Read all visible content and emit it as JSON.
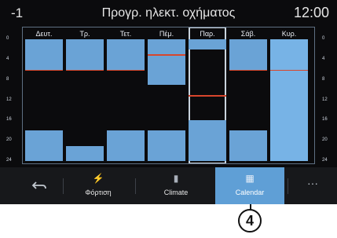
{
  "header": {
    "left": "-1",
    "title": "Προγρ. ηλεκτ. οχήματος",
    "time": "12:00"
  },
  "axis_ticks": [
    "0",
    "4",
    "8",
    "12",
    "16",
    "20",
    "24"
  ],
  "days": [
    {
      "label": "Δευτ.",
      "selected": false,
      "ranges": [
        [
          0,
          6
        ],
        [
          18,
          24
        ]
      ],
      "marker": 6
    },
    {
      "label": "Τρ.",
      "selected": false,
      "ranges": [
        [
          0,
          6
        ],
        [
          21,
          24
        ]
      ],
      "marker": 6
    },
    {
      "label": "Τετ.",
      "selected": false,
      "ranges": [
        [
          0,
          6
        ],
        [
          18,
          24
        ]
      ],
      "marker": 6
    },
    {
      "label": "Πέμ.",
      "selected": false,
      "ranges": [
        [
          0,
          9
        ],
        [
          18,
          24
        ]
      ],
      "marker": 3
    },
    {
      "label": "Παρ.",
      "selected": true,
      "ranges": [
        [
          0,
          2
        ],
        [
          16,
          24
        ]
      ],
      "marker": 11
    },
    {
      "label": "Σάβ.",
      "selected": false,
      "ranges": [
        [
          0,
          6
        ],
        [
          18,
          24
        ]
      ],
      "marker": 6
    },
    {
      "label": "Κυρ.",
      "selected": false,
      "ranges": [
        [
          0,
          24
        ]
      ],
      "marker": 6
    }
  ],
  "colors": {
    "bar": "#6aa3d6",
    "marker": "#d8462c",
    "active_tab": "#5f9fd6"
  },
  "tabbar": {
    "back": {
      "icon": "back-arrow-icon"
    },
    "tabs": [
      {
        "label": "Φόρτιση",
        "icon": "charging-icon"
      },
      {
        "label": "Climate",
        "icon": "climate-icon"
      },
      {
        "label": "Calendar",
        "icon": "calendar-icon",
        "active": true
      }
    ],
    "more": {
      "icon": "more-icon",
      "text": "···"
    }
  },
  "callout": "4"
}
